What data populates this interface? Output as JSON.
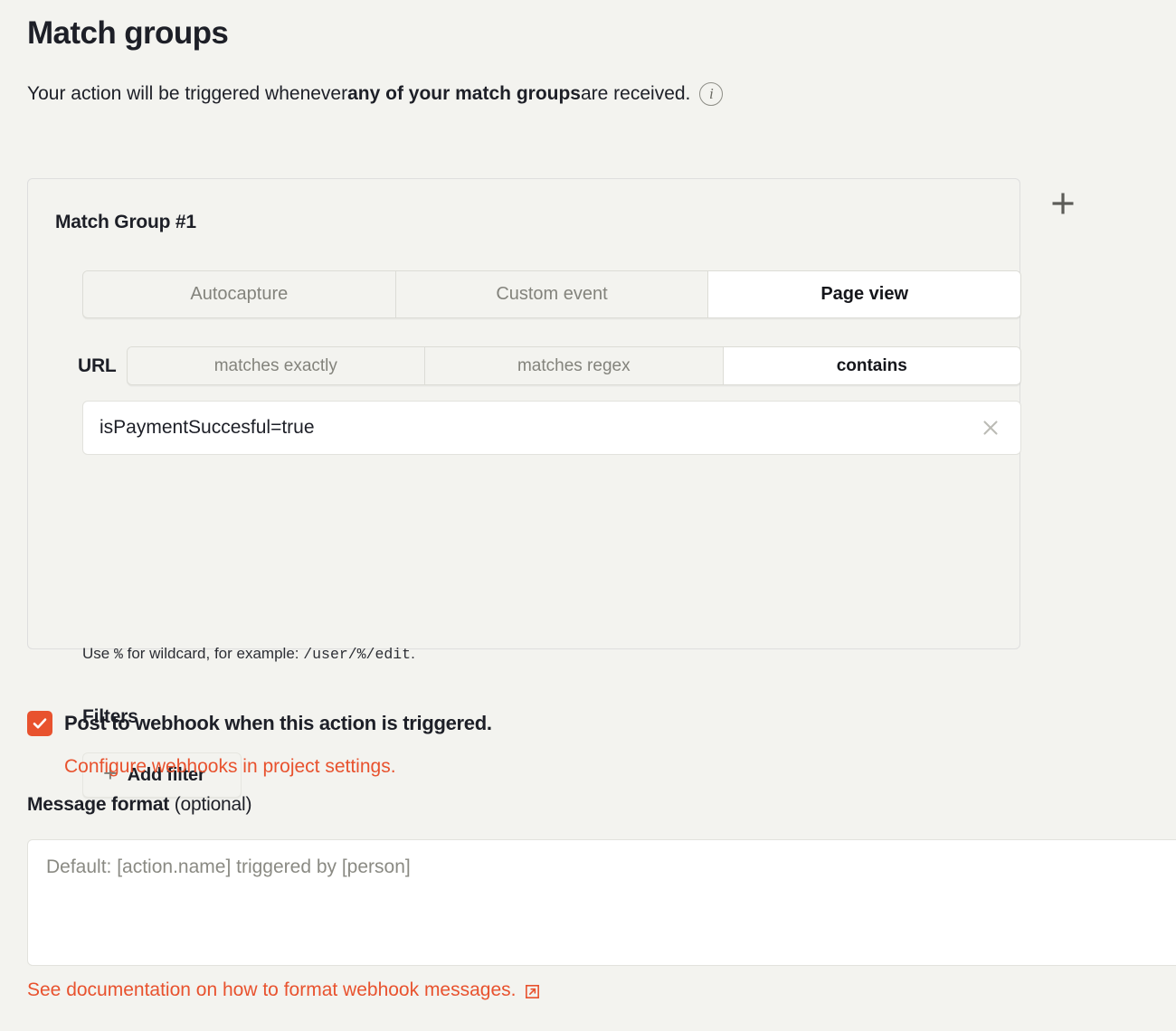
{
  "header": {
    "title": "Match groups",
    "subtitle_prefix": "Your action will be triggered whenever ",
    "subtitle_bold": "any of your match groups",
    "subtitle_suffix": " are received.",
    "info_icon": "info-icon",
    "info_glyph": "i"
  },
  "match_group": {
    "title": "Match Group #1",
    "add_group_icon": "plus-icon",
    "event_type_tabs": [
      {
        "label": "Autocapture",
        "selected": false
      },
      {
        "label": "Custom event",
        "selected": false
      },
      {
        "label": "Page view",
        "selected": true
      }
    ],
    "url": {
      "label": "URL",
      "match_tabs": [
        {
          "label": "matches exactly",
          "selected": false
        },
        {
          "label": "matches regex",
          "selected": false
        },
        {
          "label": "contains",
          "selected": true
        }
      ],
      "value": "isPaymentSuccesful=true",
      "clear_icon": "close-icon",
      "hint_prefix": "Use ",
      "hint_code_1": "%",
      "hint_middle": " for wildcard, for example: ",
      "hint_code_2": "/user/%/edit",
      "hint_suffix": "."
    },
    "filters": {
      "title": "Filters",
      "add_filter_label": "Add filter",
      "add_filter_icon": "plus-icon"
    }
  },
  "webhook": {
    "checkbox_checked": true,
    "checkbox_label": "Post to webhook when this action is triggered.",
    "configure_link": "Configure webhooks in project settings.",
    "message_format_label": "Message format",
    "message_format_optional": " (optional)",
    "message_placeholder": "Default: [action.name] triggered by [person]",
    "message_value": "",
    "doc_link": "See documentation on how to format webhook messages.",
    "doc_link_icon": "external-link-icon"
  },
  "colors": {
    "accent": "#e8522e",
    "background": "#f3f3ef",
    "text": "#1d1f27",
    "muted": "#83837c"
  }
}
